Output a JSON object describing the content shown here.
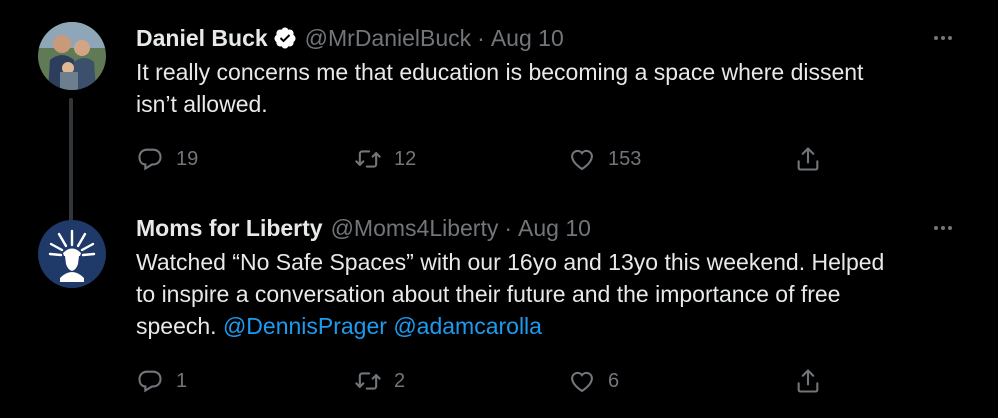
{
  "tweets": [
    {
      "author_name": "Daniel Buck",
      "verified": true,
      "handle": "@MrDanielBuck",
      "separator": "·",
      "date": "Aug 10",
      "text_line1": "It really concerns me that education is becoming a space where dissent",
      "text_line2": "isn’t allowed.",
      "replies": "19",
      "retweets": "12",
      "likes": "153",
      "avatar": "photo-avatar"
    },
    {
      "author_name": "Moms for Liberty",
      "verified": false,
      "handle": "@Moms4Liberty",
      "separator": "·",
      "date": "Aug 10",
      "text_line1": "Watched “No Safe Spaces” with our 16yo and 13yo this weekend. Helped",
      "text_line2": "to inspire a conversation about their future and the importance of free",
      "text_line3_prefix": "speech. ",
      "mention1": "@DennisPrager",
      "mention2": "@adamcarolla",
      "replies": "1",
      "retweets": "2",
      "likes": "6",
      "avatar": "statue-of-liberty-logo"
    }
  ],
  "colors": {
    "background": "#000000",
    "text": "#e7e9ea",
    "secondary": "#71767b",
    "link": "#1d9bf0",
    "verified": "#ffffff",
    "logo_bg": "#1f3a68"
  },
  "icons": [
    "verified-badge-icon",
    "more-icon",
    "reply-icon",
    "retweet-icon",
    "like-icon",
    "share-icon"
  ]
}
